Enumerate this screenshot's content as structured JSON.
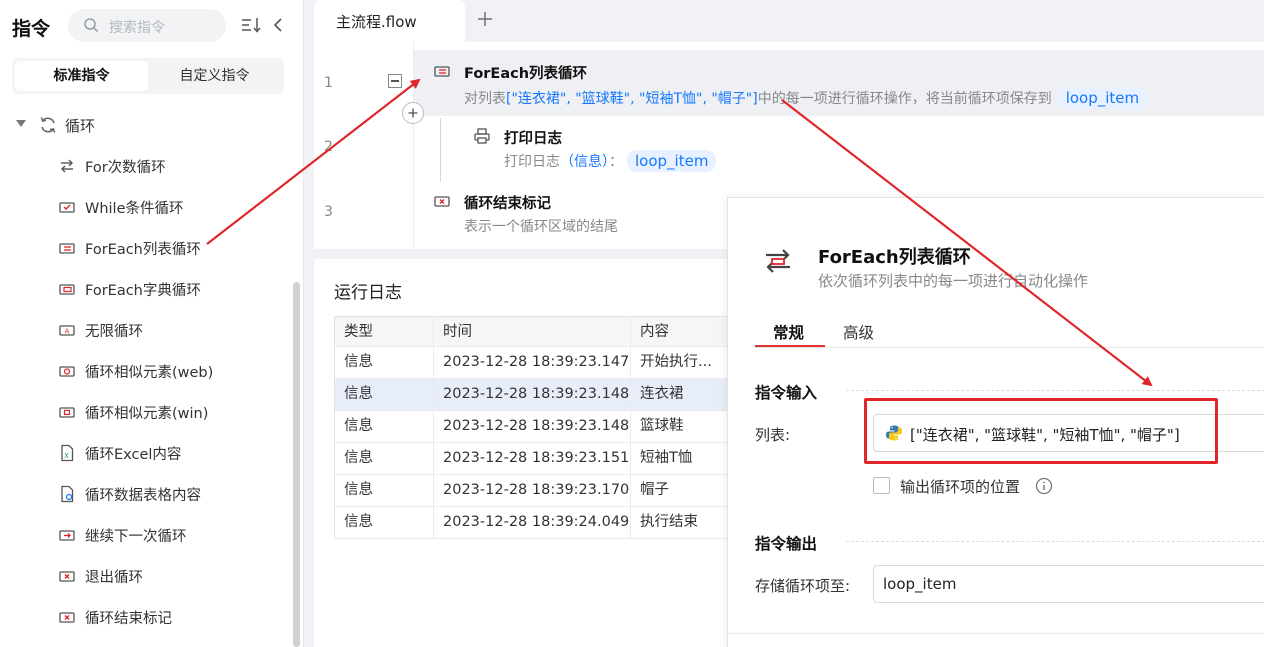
{
  "sidebar": {
    "title": "指令",
    "search_placeholder": "搜索指令",
    "tabs": [
      "标准指令",
      "自定义指令"
    ],
    "group_label": "循环",
    "items": [
      {
        "label": "For次数循环",
        "icon": "for-loop-icon"
      },
      {
        "label": "While条件循环",
        "icon": "while-loop-icon"
      },
      {
        "label": "ForEach列表循环",
        "icon": "foreach-list-icon"
      },
      {
        "label": "ForEach字典循环",
        "icon": "foreach-dict-icon"
      },
      {
        "label": "无限循环",
        "icon": "infinite-loop-icon"
      },
      {
        "label": "循环相似元素(web)",
        "icon": "loop-web-icon"
      },
      {
        "label": "循环相似元素(win)",
        "icon": "loop-win-icon"
      },
      {
        "label": "循环Excel内容",
        "icon": "excel-icon"
      },
      {
        "label": "循环数据表格内容",
        "icon": "table-icon"
      },
      {
        "label": "继续下一次循环",
        "icon": "continue-icon"
      },
      {
        "label": "退出循环",
        "icon": "break-icon"
      },
      {
        "label": "循环结束标记",
        "icon": "loop-end-icon"
      }
    ]
  },
  "editor": {
    "tab_name": "主流程.flow",
    "rows": [
      {
        "line": "1",
        "title": "ForEach列表循环",
        "desc_prefix": "对列表",
        "desc_value": "[\"连衣裙\", \"篮球鞋\", \"短袖T恤\", \"帽子\"]",
        "desc_suffix": "中的每一项进行循环操作，将当前循环项保存到",
        "var": "loop_item"
      },
      {
        "line": "2",
        "title": "打印日志",
        "desc_prefix": "打印日志",
        "desc_link": "（信息）",
        "desc_colon": "：",
        "var": "loop_item"
      },
      {
        "line": "3",
        "title": "循环结束标记",
        "desc": "表示一个循环区域的结尾"
      }
    ]
  },
  "log": {
    "title": "运行日志",
    "columns": [
      "类型",
      "时间",
      "内容"
    ],
    "rows": [
      {
        "type": "信息",
        "time": "2023-12-28 18:39:23.147",
        "content": "开始执行..."
      },
      {
        "type": "信息",
        "time": "2023-12-28 18:39:23.148",
        "content": "连衣裙"
      },
      {
        "type": "信息",
        "time": "2023-12-28 18:39:23.148",
        "content": "篮球鞋"
      },
      {
        "type": "信息",
        "time": "2023-12-28 18:39:23.151",
        "content": "短袖T恤"
      },
      {
        "type": "信息",
        "time": "2023-12-28 18:39:23.170",
        "content": "帽子"
      },
      {
        "type": "信息",
        "time": "2023-12-28 18:39:24.049",
        "content": "执行结束"
      }
    ]
  },
  "panel": {
    "title": "ForEach列表循环",
    "subtitle": "依次循环列表中的每一项进行自动化操作",
    "tabs": [
      "常规",
      "高级"
    ],
    "input_section": "指令输入",
    "list_label": "列表:",
    "list_value": "[\"连衣裙\", \"篮球鞋\", \"短袖T恤\", \"帽子\"]",
    "checkbox_label": "输出循环项的位置",
    "output_section": "指令输出",
    "store_label": "存储循环项至:",
    "store_value": "loop_item"
  },
  "colors": {
    "accent_red": "#e0262b",
    "link_blue": "#1677ff",
    "selected_row": "#e8eef9"
  }
}
